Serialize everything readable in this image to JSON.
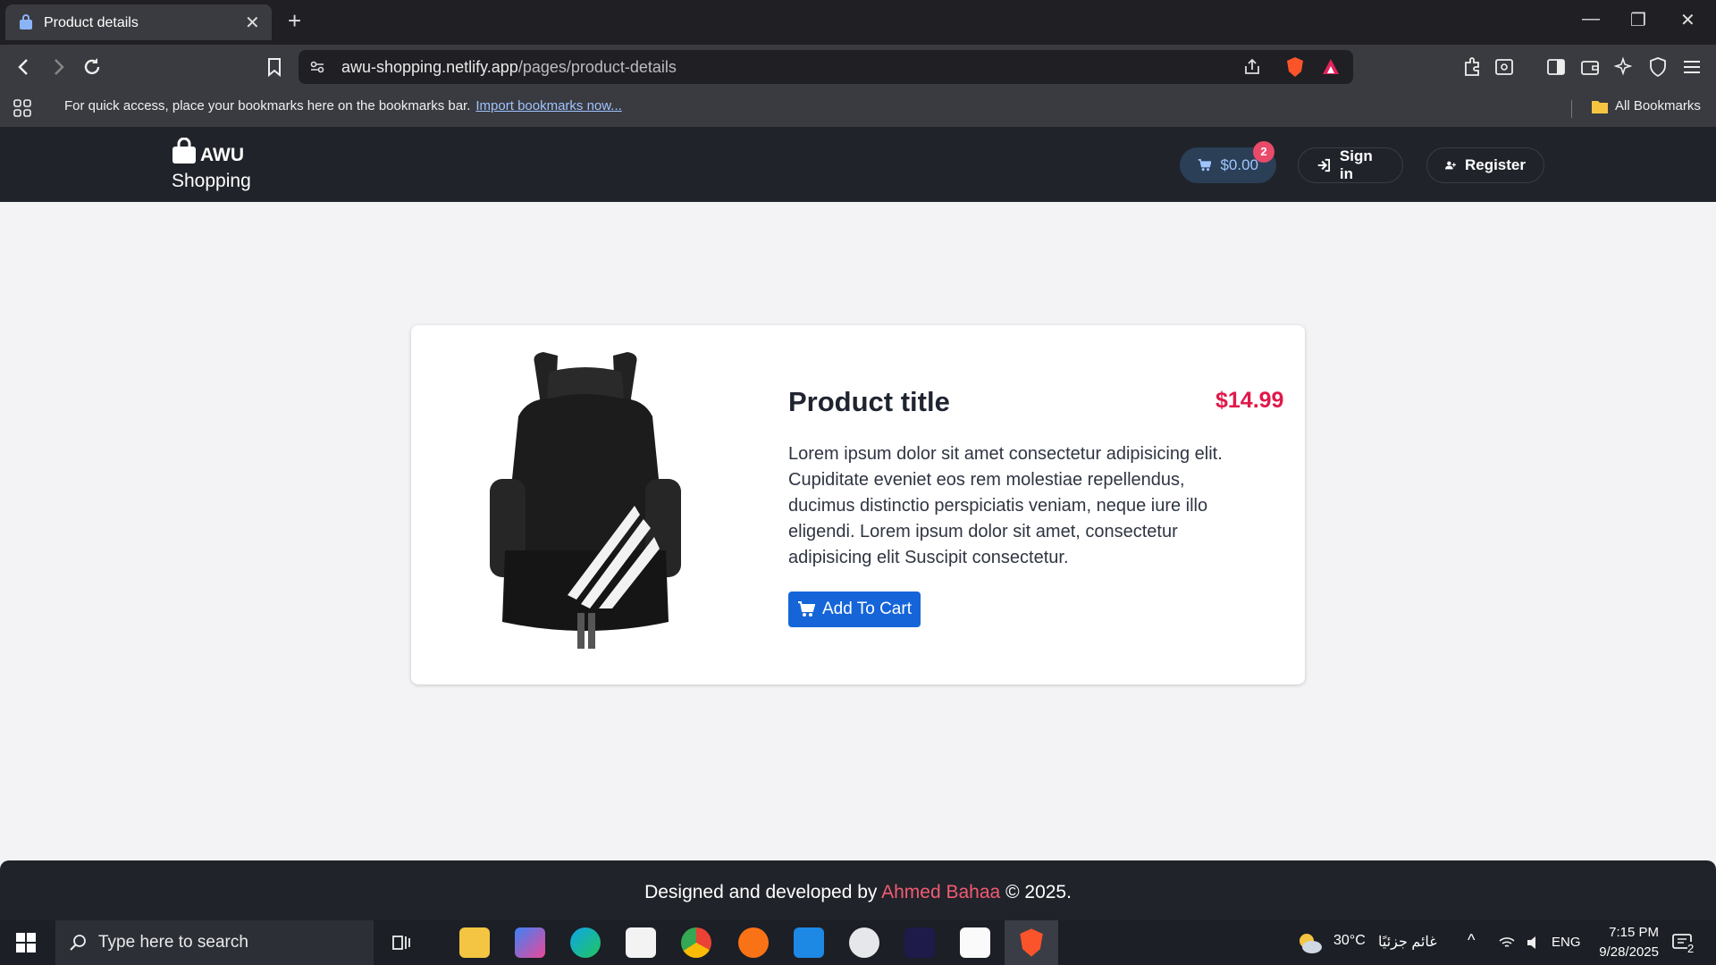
{
  "browser": {
    "tab_title": "Product details",
    "new_tab": "+",
    "url_host": "awu-shopping.netlify.app",
    "url_path": "/pages/product-details",
    "bookmarks_message": "For quick access, place your bookmarks here on the bookmarks bar.",
    "bookmarks_link": "Import bookmarks now...",
    "all_bookmarks": "All Bookmarks"
  },
  "site": {
    "brand_line1": "AWU",
    "brand_line2": "Shopping",
    "cart_total": "$0.00",
    "cart_count": "2",
    "signin_label": "Sign in",
    "register_label": "Register"
  },
  "product": {
    "title": "Product title",
    "price": "$14.99",
    "description": "Lorem ipsum dolor sit amet consectetur adipisicing elit. Cupiditate eveniet eos rem molestiae repellendus, ducimus distinctio perspiciatis veniam, neque iure illo eligendi. Lorem ipsum dolor sit amet, consectetur adipisicing elit Suscipit consectetur.",
    "add_to_cart": "Add To Cart"
  },
  "footer": {
    "prefix": "Designed and developed by",
    "author": "Ahmed Bahaa",
    "suffix": "© 2025."
  },
  "taskbar": {
    "search_placeholder": "Type here to search",
    "weather": "30°C",
    "weather_desc": "غائم جزئيًا",
    "lang": "ENG",
    "time": "7:15 PM",
    "date": "9/28/2025",
    "notif_count": "2"
  },
  "colors": {
    "accent": "#1565d8",
    "price": "#e0194a",
    "author": "#f35b72",
    "navbar": "#20232a"
  }
}
